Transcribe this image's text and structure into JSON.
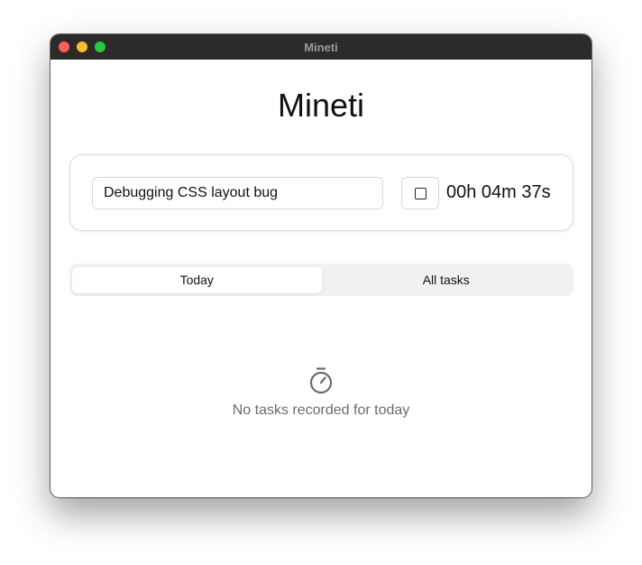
{
  "window": {
    "title": "Mineti"
  },
  "app": {
    "title": "Mineti"
  },
  "timer": {
    "task_value": "Debugging CSS layout bug",
    "stop_icon": "stop-icon",
    "elapsed": "00h 04m 37s"
  },
  "tabs": [
    {
      "label": "Today",
      "active": true
    },
    {
      "label": "All tasks",
      "active": false
    }
  ],
  "empty_state": {
    "icon": "stopwatch-icon",
    "message": "No tasks recorded for today"
  },
  "colors": {
    "titlebar": "#2c2b29",
    "close": "#fe5f57",
    "minimize": "#febc2e",
    "maximize": "#28c840",
    "muted_text": "#6b6b6b"
  }
}
